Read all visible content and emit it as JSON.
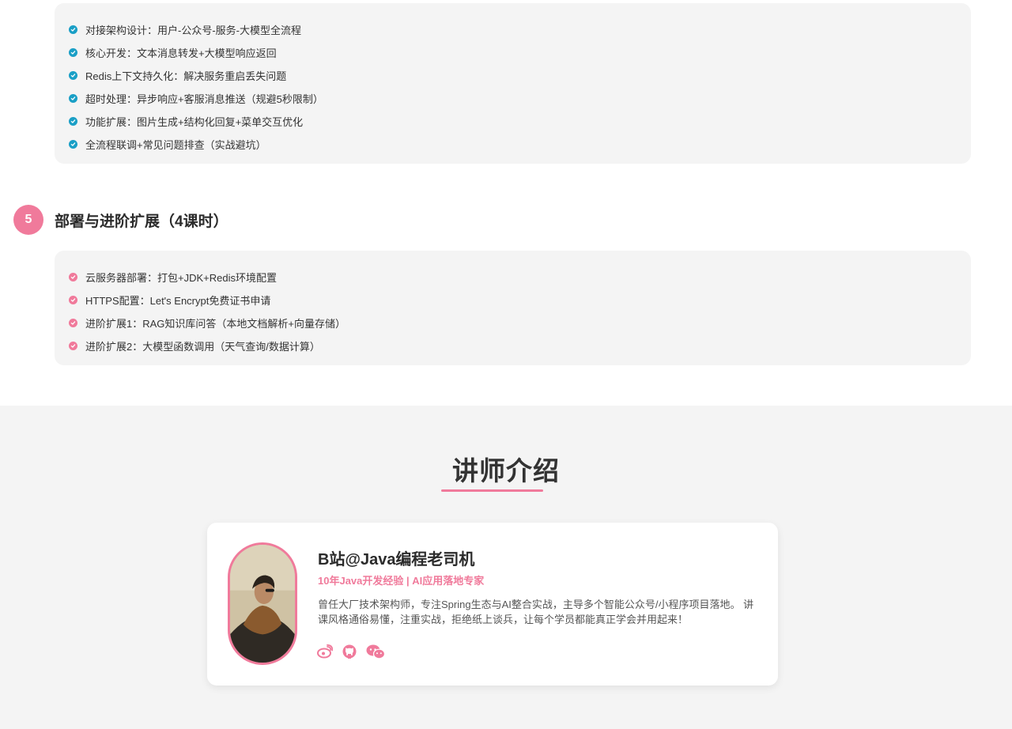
{
  "module4": {
    "items": [
      "对接架构设计：用户-公众号-服务-大模型全流程",
      "核心开发：文本消息转发+大模型响应返回",
      "Redis上下文持久化：解决服务重启丢失问题",
      "超时处理：异步响应+客服消息推送（规避5秒限制）",
      "功能扩展：图片生成+结构化回复+菜单交互优化",
      "全流程联调+常见问题排查（实战避坑）"
    ],
    "check_color": "#1a9fc6"
  },
  "module5": {
    "number": "5",
    "title": "部署与进阶扩展（4课时）",
    "items": [
      "云服务器部署：打包+JDK+Redis环境配置",
      "HTTPS配置：Let's Encrypt免费证书申请",
      "进阶扩展1：RAG知识库问答（本地文档解析+向量存储）",
      "进阶扩展2：大模型函数调用（天气查询/数据计算）"
    ],
    "check_color": "#f07a9b"
  },
  "instructor_section": {
    "title": "讲师介绍",
    "name": "B站@Java编程老司机",
    "subtitle": "10年Java开发经验 | AI应用落地专家",
    "description": "曾任大厂技术架构师，专注Spring生态与AI整合实战，主导多个智能公众号/小程序项目落地。 讲课风格通俗易懂，注重实战，拒绝纸上谈兵，让每个学员都能真正学会并用起来！",
    "social_icons": [
      "weibo-icon",
      "github-icon",
      "wechat-icon"
    ]
  },
  "colors": {
    "accent_pink": "#f07a9b",
    "accent_teal": "#1a9fc6",
    "panel_bg": "#f4f4f4"
  }
}
